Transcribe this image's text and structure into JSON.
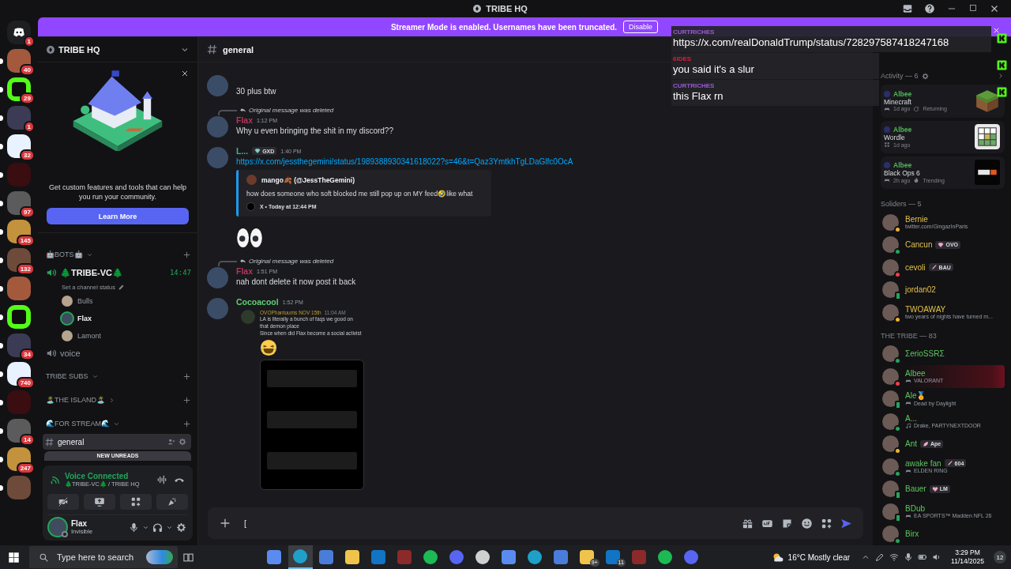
{
  "window": {
    "title": "TRIBE HQ"
  },
  "banner": {
    "text": "Streamer Mode is enabled. Usernames have been truncated.",
    "button": "Disable"
  },
  "servers": [
    {
      "kind": "home",
      "badge": "1",
      "unread": false
    },
    {
      "badge": "40",
      "unread": true
    },
    {
      "badge": "29",
      "unread": true
    },
    {
      "badge": "1",
      "unread": true
    },
    {
      "badge": "32",
      "unread": true
    },
    {
      "unread": true
    },
    {
      "badge": "97",
      "unread": true
    },
    {
      "badge": "145",
      "unread": true
    },
    {
      "badge": "132",
      "unread": true
    },
    {
      "unread": true
    },
    {
      "unread": true
    },
    {
      "badge": "34",
      "unread": true
    },
    {
      "badge": "740",
      "unread": true
    },
    {
      "unread": true
    },
    {
      "badge": "14",
      "unread": true
    },
    {
      "badge": "247",
      "unread": true
    },
    {
      "unread": true
    }
  ],
  "sidebar": {
    "server_name": "TRIBE HQ",
    "promo": {
      "text": "Get custom features and tools that can help you run your community.",
      "button": "Learn More"
    },
    "channels": [
      {
        "kind": "category",
        "name": "🤖BOTS🤖",
        "expanded": true,
        "children": [
          {
            "kind": "voice",
            "name": "🌲TRIBE-VC🌲",
            "time": "14:47",
            "status_placeholder": "Set a channel status",
            "children": [
              {
                "kind": "user",
                "name": "Bulls",
                "speaking": false
              },
              {
                "kind": "user",
                "name": "Flax",
                "speaking": true
              },
              {
                "kind": "user",
                "name": "Lamont",
                "speaking": false
              }
            ]
          },
          {
            "kind": "voice",
            "name": "voice"
          }
        ]
      },
      {
        "kind": "category",
        "name": "TRIBE SUBS",
        "expanded": true
      },
      {
        "kind": "category",
        "name": "🏝️THE ISLAND🏝️",
        "expanded": false
      },
      {
        "kind": "category",
        "name": "🌊FOR STREAM🌊",
        "expanded": true,
        "children": [
          {
            "kind": "text",
            "name": "general",
            "selected": true
          }
        ]
      }
    ],
    "new_unreads": "NEW UNREADS",
    "voice": {
      "status": "Voice Connected",
      "channel": "🌲TRIBE-VC🌲 / TRIBE HQ"
    },
    "user": {
      "name": "Flax",
      "status": "Invisible"
    }
  },
  "chat": {
    "channel": "general",
    "messages": [
      {
        "kind": "continuation",
        "text": "30 plus btw"
      },
      {
        "kind": "message",
        "reply": "Original message was deleted",
        "author": "Flax",
        "color": "#b8335a",
        "time": "1:12 PM",
        "text": "Why u even bringing the shit in my discord??"
      },
      {
        "kind": "message",
        "author": "L...",
        "color": "#43b581",
        "tag": "GXD",
        "time": "1:40 PM",
        "link": "https://x.com/jessthegemini/status/1989388930341618022?s=46&t=Qaz3YmtkhTgLDaGlfc0OcA",
        "embed": {
          "author": "mango🍂 (@JessTheGemini)",
          "text": "how does someone who soft blocked me still pop up on MY feed🤣like what",
          "footer": "X • Today at 12:44 PM"
        },
        "big_emoji": {
          "kind": "eyes"
        }
      },
      {
        "kind": "message",
        "reply": "Original message was deleted",
        "author": "Flax",
        "color": "#b8335a",
        "time": "1:51 PM",
        "text": "nah dont delete it now post it back"
      },
      {
        "kind": "message",
        "author": "Cocoacool",
        "color": "#5fcf72",
        "time": "1:52 PM",
        "forward": {
          "author": "OVOPhantuums NOV 15th",
          "time": "11:04 AM",
          "lines": [
            "LA is literally a bunch of faqs we good on that demon place",
            "Since when did Flax become a social activist"
          ],
          "big_emoji": {
            "kind": "laughing"
          },
          "image": true
        }
      }
    ],
    "composer": {
      "value": "["
    }
  },
  "overlay": {
    "messages": [
      {
        "author": "CURTRICHES",
        "color": "#9b59d6",
        "text": "https://x.com/realDonaldTrump/status/728297587418247168",
        "wide": true
      },
      {
        "author": "6IDES",
        "color": "#d0213f",
        "text": "you said it's a slur",
        "wide": false
      },
      {
        "author": "CURTRICHES",
        "color": "#9b59d6",
        "text": "this Flax rn",
        "wide": false
      }
    ]
  },
  "members": {
    "activity": {
      "title": "Activity — 6",
      "cards": [
        {
          "user": "Albee",
          "game": "Minecraft",
          "kind": "grass-block",
          "meta": [
            "1d ago",
            "Returning"
          ]
        },
        {
          "user": "Albee",
          "game": "Wordle",
          "kind": "letter-grid",
          "meta": [
            "1d ago"
          ]
        },
        {
          "user": "Albee",
          "game": "Black Ops 6",
          "kind": "game-logo",
          "meta": [
            "2h ago",
            "Trending"
          ]
        }
      ]
    },
    "groups": [
      {
        "title": "Soliders — 5",
        "color": "#e3c04a",
        "members": [
          {
            "name": "Bernie",
            "status": {
              "kind": "idle"
            },
            "subtitle": "twitter.com/GingazInParis"
          },
          {
            "name": "Cancun",
            "status": {
              "kind": "online"
            },
            "tag": "OVO"
          },
          {
            "name": "cevoli",
            "status": {
              "kind": "dnd"
            },
            "tag": "BAU"
          },
          {
            "name": "jordan02",
            "status": {
              "kind": "mobile"
            }
          },
          {
            "name": "TWOAWAY",
            "status": {
              "kind": "idle"
            },
            "subtitle": "two years of nights have turned m..."
          }
        ]
      },
      {
        "title": "THE TRIBE — 83",
        "color": "#5cc65e",
        "members": [
          {
            "name": "ΣerioSSRΣ",
            "status": {
              "kind": "online"
            }
          },
          {
            "name": "Albee",
            "status": {
              "kind": "dnd"
            },
            "activity": {
              "kind": "game",
              "text": "VALORANT"
            },
            "nameplate": true
          },
          {
            "name": "Ale🏅",
            "status": {
              "kind": "mobile"
            },
            "activity": {
              "kind": "game",
              "text": "Dead by Daylight"
            }
          },
          {
            "name": "A...",
            "status": {
              "kind": "online"
            },
            "activity": {
              "kind": "music",
              "text": "Drake, PARTYNEXTDOOR"
            }
          },
          {
            "name": "Ant",
            "status": {
              "kind": "idle"
            },
            "tag": "Ape"
          },
          {
            "name": "awake fan",
            "status": {
              "kind": "online"
            },
            "tag": "604",
            "activity": {
              "kind": "game",
              "text": "ELDEN RING"
            }
          },
          {
            "name": "Bauer",
            "status": {
              "kind": "mobile"
            },
            "tag": "LM"
          },
          {
            "name": "BDub",
            "status": {
              "kind": "mobile"
            },
            "activity": {
              "kind": "game",
              "text": "EA SPORTS™ Madden NFL 26"
            }
          },
          {
            "name": "Birx",
            "status": {
              "kind": "online"
            }
          }
        ]
      }
    ]
  },
  "taskbar": {
    "search_placeholder": "Type here to search",
    "apps": [
      {
        "selected": false
      },
      {
        "selected": true
      },
      {
        "selected": false
      },
      {
        "selected": false
      },
      {
        "selected": false
      },
      {
        "selected": false
      },
      {
        "selected": false
      },
      {
        "selected": false
      },
      {
        "selected": false
      },
      {
        "selected": false
      },
      {
        "selected": false
      },
      {
        "selected": false
      },
      {
        "selected": false,
        "badge": "9+"
      },
      {
        "selected": false,
        "badge": "11"
      },
      {
        "selected": false
      },
      {
        "selected": false
      },
      {
        "selected": false
      }
    ],
    "weather": "16°C Mostly clear",
    "time": "3:29 PM",
    "date": "11/14/2025",
    "notifications": "12"
  }
}
